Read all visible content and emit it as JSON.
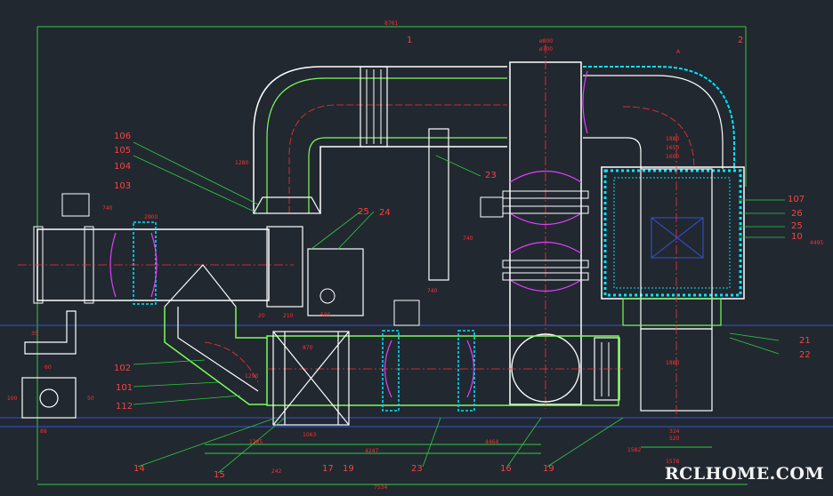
{
  "watermark": "RCLHOME.COM",
  "colors": {
    "background": "#212830",
    "structure": "#7CFC5A",
    "outline": "#FFFFFF",
    "dimension": "#FF3030",
    "leader": "#2ECC40",
    "accent_cyan": "#00E5FF",
    "accent_magenta": "#E040FB",
    "guide_blue": "#3A4FD8",
    "label": "#FF4040"
  },
  "callouts": {
    "c1": "1",
    "c2": "2",
    "c23": "23",
    "c24": "24",
    "c25a": "25",
    "c106": "106",
    "c105": "105",
    "c104": "104",
    "c103": "103",
    "c107": "107",
    "c26": "26",
    "c25b": "25",
    "c10": "10",
    "c21": "21",
    "c22": "22",
    "c102": "102",
    "c101": "101",
    "c112": "112",
    "c14": "14",
    "c15": "15",
    "c17": "17",
    "c19a": "19",
    "c23b": "23",
    "c16": "16",
    "c19b": "19"
  },
  "dimensions": {
    "top_overall": "8761",
    "d_bottom_overall": "7534",
    "d_4464": "4464",
    "d_4247": "4247",
    "d_1582": "1582",
    "d_1578": "1578",
    "d_1063": "1063",
    "d_1285": "1285",
    "d_242": "242",
    "d_740a": "740",
    "d_740b": "740",
    "d_740c": "740",
    "d_2900": "2900",
    "d_1280": "1280",
    "d_1290": "1290",
    "d_1880a": "1880",
    "d_1880b": "1880",
    "d_1650": "1650",
    "d_1600": "1600",
    "d_4495": "4495",
    "d_phi800": "ø800",
    "d_phi700": "ø700",
    "d_500": "500",
    "d_324": "324",
    "d_520": "520",
    "d_870": "870",
    "d_210": "210",
    "d_20": "20",
    "d_35": "35",
    "d_60": "60",
    "d_88": "88",
    "d_100": "100",
    "d_50": "50",
    "d_A": "A"
  }
}
